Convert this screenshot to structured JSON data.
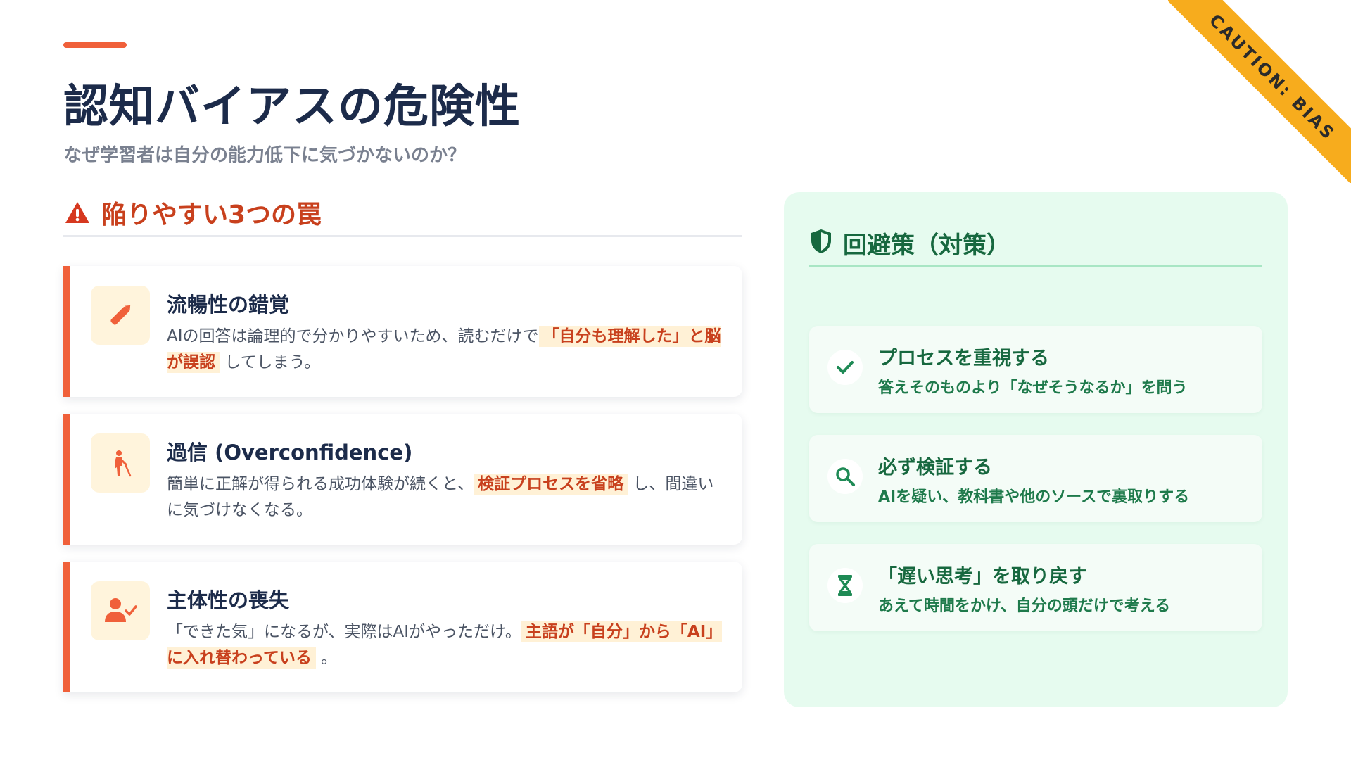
{
  "header": {
    "title": "認知バイアスの危険性",
    "subtitle": "なぜ学習者は自分の能力低下に気づかないのか？"
  },
  "ribbon": {
    "label": "CAUTION: BIAS",
    "color": "#f7ac1d"
  },
  "traps": {
    "heading": "陥りやすい3つの罠",
    "icon": "warning-triangle-icon",
    "items": [
      {
        "icon": "pencil-icon",
        "title": "流暢性の錯覚",
        "text_before": "AIの回答は論理的で分かりやすいため、読むだけで",
        "highlight": "「自分も理解した」と脳が誤認",
        "text_after": "してしまう。"
      },
      {
        "icon": "person-with-cane-icon",
        "title": "過信 (Overconfidence)",
        "text_before": "簡単に正解が得られる成功体験が続くと、",
        "highlight": "検証プロセスを省略",
        "text_after": "し、間違いに気づけなくなる。"
      },
      {
        "icon": "person-check-icon",
        "title": "主体性の喪失",
        "text_before": "「できた気」になるが、実際はAIがやっただけ。",
        "highlight": "主語が「自分」から「AI」に入れ替わっている",
        "text_after": "。"
      }
    ]
  },
  "countermeasures": {
    "heading": "回避策（対策）",
    "icon": "shield-icon",
    "items": [
      {
        "icon": "check-icon",
        "title": "プロセスを重視する",
        "desc": "答えそのものより「なぜそうなるか」を問う"
      },
      {
        "icon": "search-icon",
        "title": "必ず検証する",
        "desc": "AIを疑い、教科書や他のソースで裏取りする"
      },
      {
        "icon": "hourglass-icon",
        "title": "「遅い思考」を取り戻す",
        "desc": "あえて時間をかけ、自分の頭だけで考える"
      }
    ]
  },
  "colors": {
    "accent": "#f0603a",
    "trap_heading": "#c8401d",
    "panel_bg": "#e6fbef",
    "panel_text": "#17683f",
    "highlight_bg": "#fff1d6"
  }
}
